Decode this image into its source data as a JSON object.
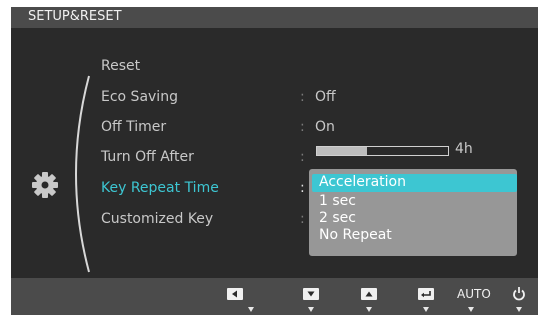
{
  "window": {
    "title": "SETUP&RESET"
  },
  "menu": {
    "items": [
      {
        "label": "Reset",
        "value": ""
      },
      {
        "label": "Eco Saving",
        "value": "Off"
      },
      {
        "label": "Off Timer",
        "value": "On"
      },
      {
        "label": "Turn Off After",
        "value": "4h",
        "slider_level": 0.38
      },
      {
        "label": "Key Repeat Time",
        "value": "",
        "selected": true
      },
      {
        "label": "Customized Key",
        "value": ""
      }
    ],
    "separator": ":"
  },
  "dropdown": {
    "options": [
      "Acceleration",
      "1 sec",
      "2 sec",
      "No Repeat"
    ],
    "highlighted": "Acceleration"
  },
  "bottom_bar": {
    "buttons": [
      {
        "icon": "left-arrow-icon"
      },
      {
        "icon": "down-arrow-icon"
      },
      {
        "icon": "up-arrow-icon"
      },
      {
        "icon": "enter-icon"
      },
      {
        "label": "AUTO"
      },
      {
        "icon": "power-icon"
      }
    ]
  },
  "colors": {
    "background": "#2a2a2a",
    "bar": "#4b4b4b",
    "accent": "#3dc6d2",
    "dropdown": "#979797",
    "text": "#c8c8c8"
  }
}
